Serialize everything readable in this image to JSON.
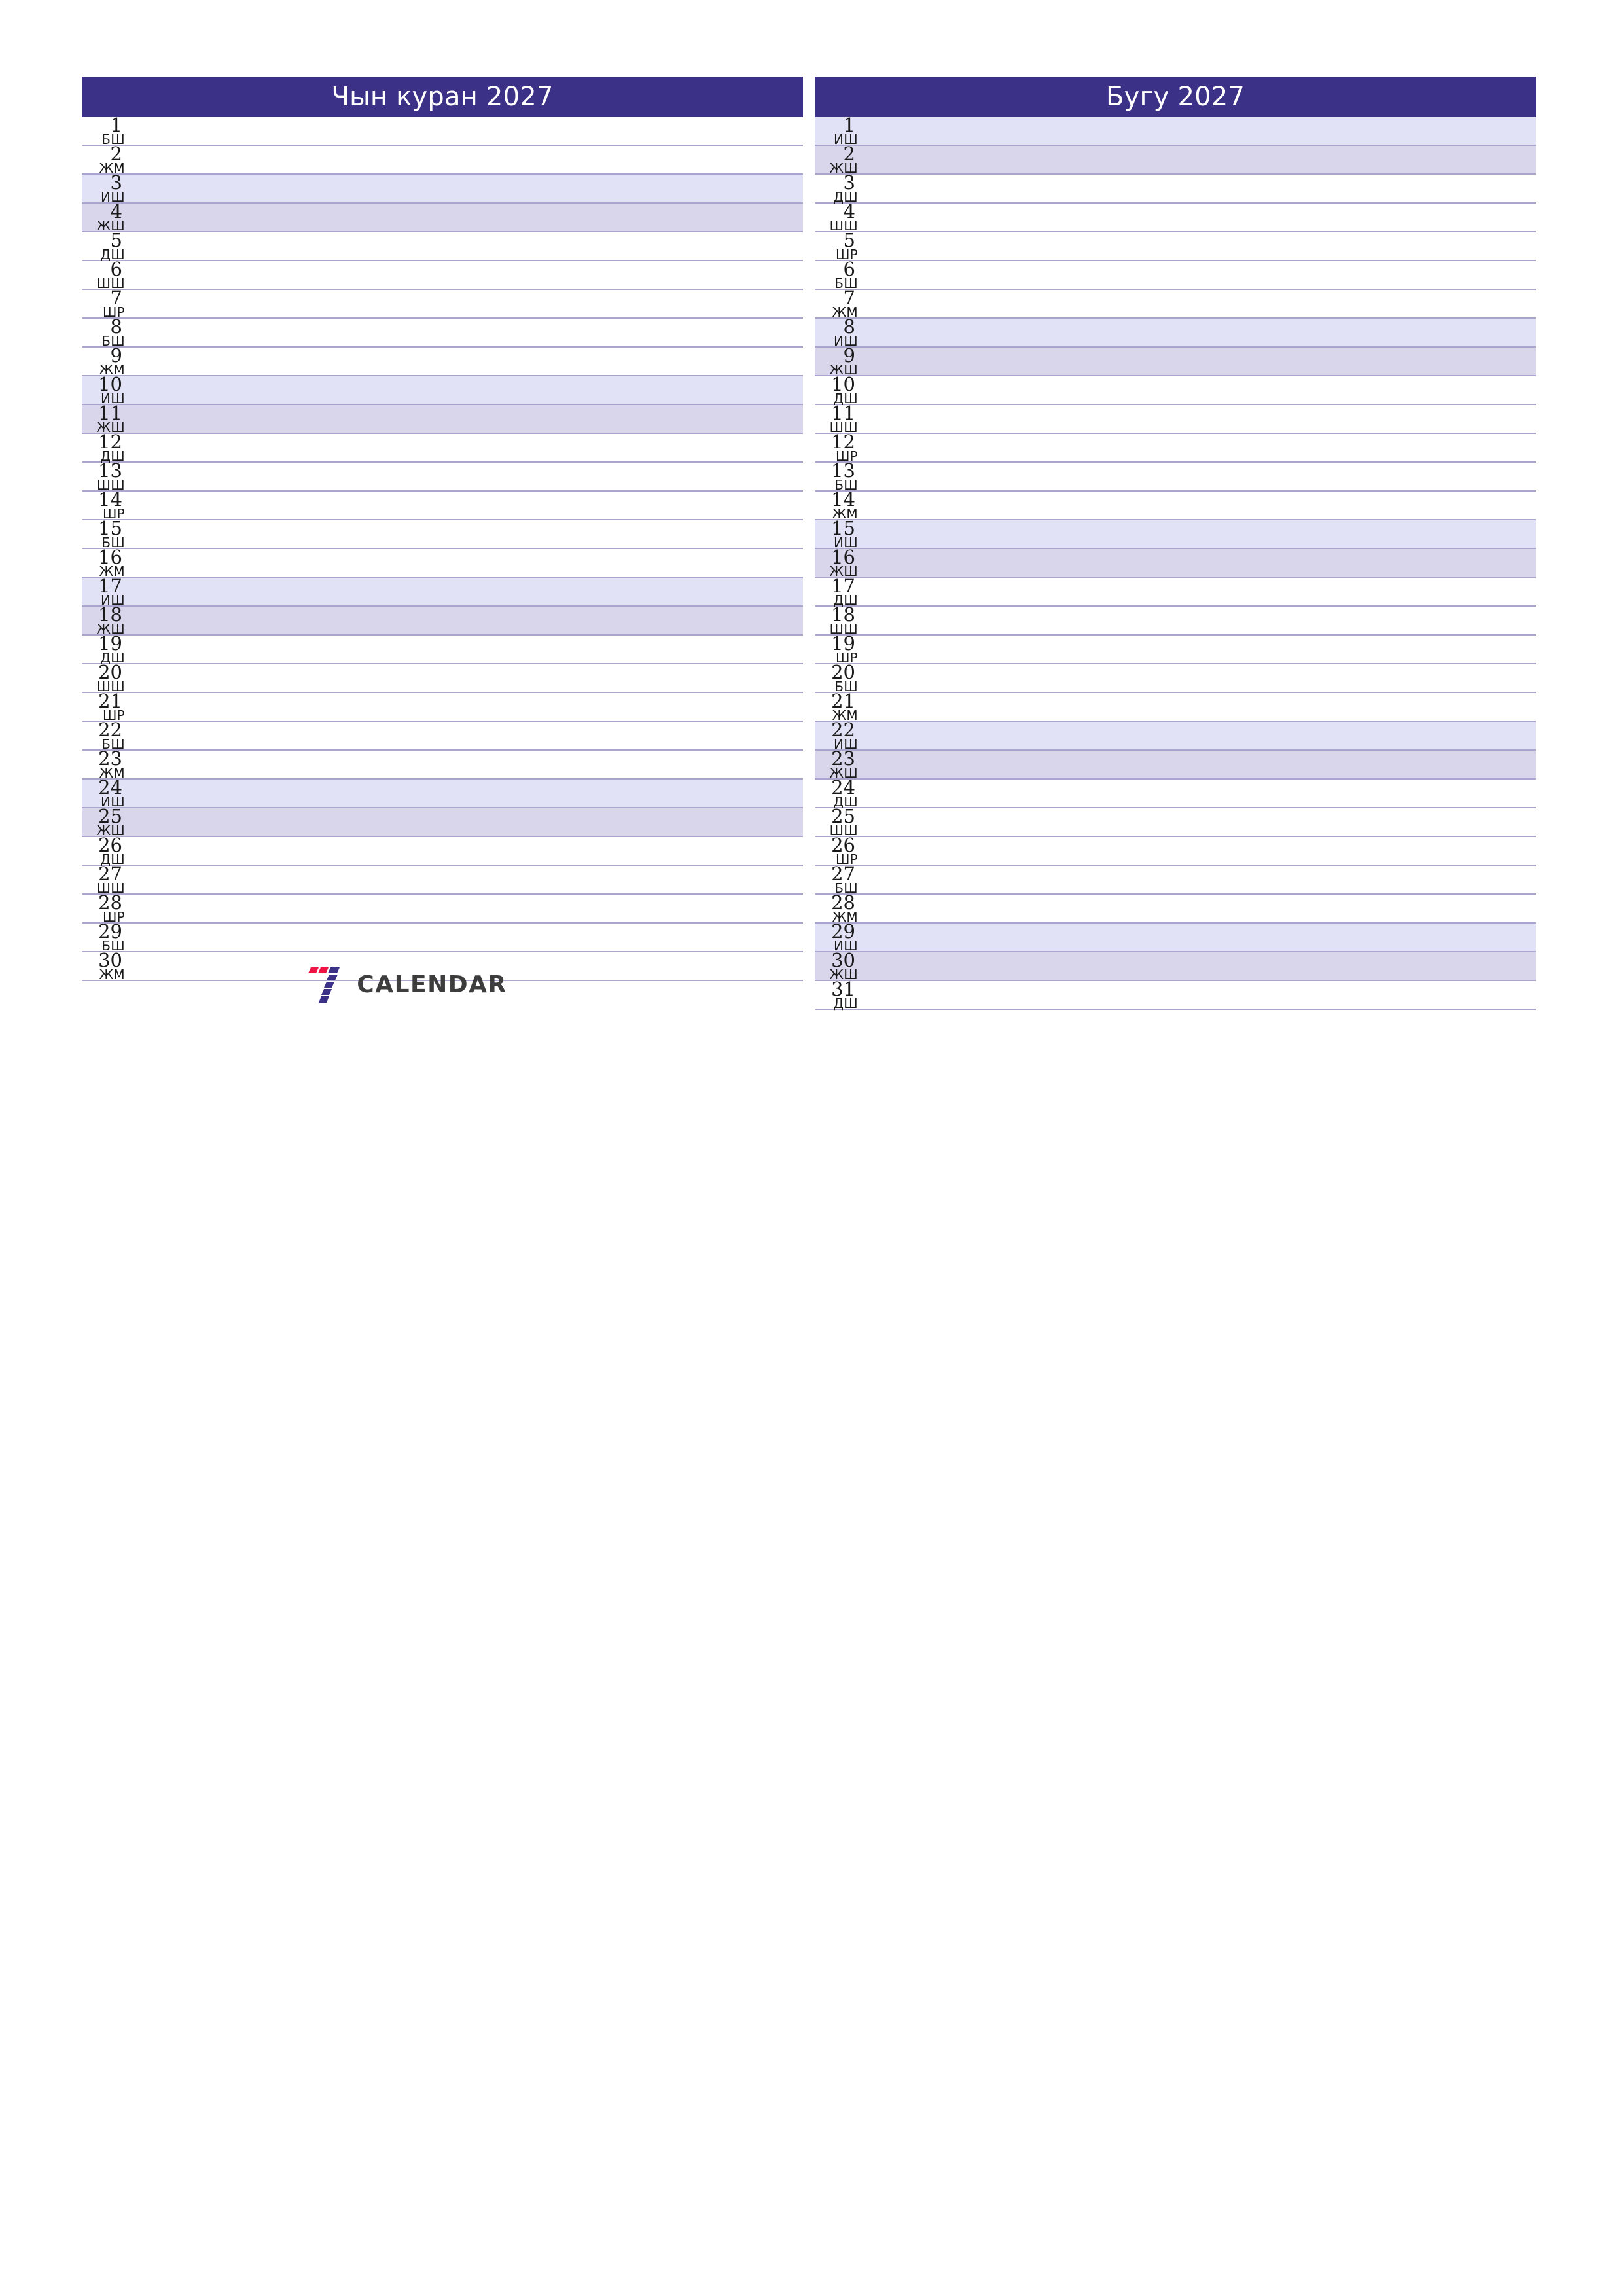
{
  "page": {
    "background": "#ffffff",
    "header_color": "#3b3288",
    "saturday_color": "#e2e2f6",
    "sunday_color": "#d9d6ec",
    "gridline_color": "#a9a5cc"
  },
  "brand": {
    "name": "CALENDAR",
    "mark_colors": [
      "#f01446",
      "#3b3288"
    ]
  },
  "months": [
    {
      "title": "Чын куран 2027",
      "days": [
        {
          "num": "1",
          "dow": "БШ",
          "type": "weekday"
        },
        {
          "num": "2",
          "dow": "ЖМ",
          "type": "weekday"
        },
        {
          "num": "3",
          "dow": "ИШ",
          "type": "sat"
        },
        {
          "num": "4",
          "dow": "ЖШ",
          "type": "sun"
        },
        {
          "num": "5",
          "dow": "ДШ",
          "type": "weekday"
        },
        {
          "num": "6",
          "dow": "ШШ",
          "type": "weekday"
        },
        {
          "num": "7",
          "dow": "ШР",
          "type": "weekday"
        },
        {
          "num": "8",
          "dow": "БШ",
          "type": "weekday"
        },
        {
          "num": "9",
          "dow": "ЖМ",
          "type": "weekday"
        },
        {
          "num": "10",
          "dow": "ИШ",
          "type": "sat"
        },
        {
          "num": "11",
          "dow": "ЖШ",
          "type": "sun"
        },
        {
          "num": "12",
          "dow": "ДШ",
          "type": "weekday"
        },
        {
          "num": "13",
          "dow": "ШШ",
          "type": "weekday"
        },
        {
          "num": "14",
          "dow": "ШР",
          "type": "weekday"
        },
        {
          "num": "15",
          "dow": "БШ",
          "type": "weekday"
        },
        {
          "num": "16",
          "dow": "ЖМ",
          "type": "weekday"
        },
        {
          "num": "17",
          "dow": "ИШ",
          "type": "sat"
        },
        {
          "num": "18",
          "dow": "ЖШ",
          "type": "sun"
        },
        {
          "num": "19",
          "dow": "ДШ",
          "type": "weekday"
        },
        {
          "num": "20",
          "dow": "ШШ",
          "type": "weekday"
        },
        {
          "num": "21",
          "dow": "ШР",
          "type": "weekday"
        },
        {
          "num": "22",
          "dow": "БШ",
          "type": "weekday"
        },
        {
          "num": "23",
          "dow": "ЖМ",
          "type": "weekday"
        },
        {
          "num": "24",
          "dow": "ИШ",
          "type": "sat"
        },
        {
          "num": "25",
          "dow": "ЖШ",
          "type": "sun"
        },
        {
          "num": "26",
          "dow": "ДШ",
          "type": "weekday"
        },
        {
          "num": "27",
          "dow": "ШШ",
          "type": "weekday"
        },
        {
          "num": "28",
          "dow": "ШР",
          "type": "weekday"
        },
        {
          "num": "29",
          "dow": "БШ",
          "type": "weekday"
        },
        {
          "num": "30",
          "dow": "ЖМ",
          "type": "weekday"
        }
      ]
    },
    {
      "title": "Бугу 2027",
      "days": [
        {
          "num": "1",
          "dow": "ИШ",
          "type": "sat"
        },
        {
          "num": "2",
          "dow": "ЖШ",
          "type": "sun"
        },
        {
          "num": "3",
          "dow": "ДШ",
          "type": "weekday"
        },
        {
          "num": "4",
          "dow": "ШШ",
          "type": "weekday"
        },
        {
          "num": "5",
          "dow": "ШР",
          "type": "weekday"
        },
        {
          "num": "6",
          "dow": "БШ",
          "type": "weekday"
        },
        {
          "num": "7",
          "dow": "ЖМ",
          "type": "weekday"
        },
        {
          "num": "8",
          "dow": "ИШ",
          "type": "sat"
        },
        {
          "num": "9",
          "dow": "ЖШ",
          "type": "sun"
        },
        {
          "num": "10",
          "dow": "ДШ",
          "type": "weekday"
        },
        {
          "num": "11",
          "dow": "ШШ",
          "type": "weekday"
        },
        {
          "num": "12",
          "dow": "ШР",
          "type": "weekday"
        },
        {
          "num": "13",
          "dow": "БШ",
          "type": "weekday"
        },
        {
          "num": "14",
          "dow": "ЖМ",
          "type": "weekday"
        },
        {
          "num": "15",
          "dow": "ИШ",
          "type": "sat"
        },
        {
          "num": "16",
          "dow": "ЖШ",
          "type": "sun"
        },
        {
          "num": "17",
          "dow": "ДШ",
          "type": "weekday"
        },
        {
          "num": "18",
          "dow": "ШШ",
          "type": "weekday"
        },
        {
          "num": "19",
          "dow": "ШР",
          "type": "weekday"
        },
        {
          "num": "20",
          "dow": "БШ",
          "type": "weekday"
        },
        {
          "num": "21",
          "dow": "ЖМ",
          "type": "weekday"
        },
        {
          "num": "22",
          "dow": "ИШ",
          "type": "sat"
        },
        {
          "num": "23",
          "dow": "ЖШ",
          "type": "sun"
        },
        {
          "num": "24",
          "dow": "ДШ",
          "type": "weekday"
        },
        {
          "num": "25",
          "dow": "ШШ",
          "type": "weekday"
        },
        {
          "num": "26",
          "dow": "ШР",
          "type": "weekday"
        },
        {
          "num": "27",
          "dow": "БШ",
          "type": "weekday"
        },
        {
          "num": "28",
          "dow": "ЖМ",
          "type": "weekday"
        },
        {
          "num": "29",
          "dow": "ИШ",
          "type": "sat"
        },
        {
          "num": "30",
          "dow": "ЖШ",
          "type": "sun"
        },
        {
          "num": "31",
          "dow": "ДШ",
          "type": "weekday"
        }
      ]
    }
  ]
}
